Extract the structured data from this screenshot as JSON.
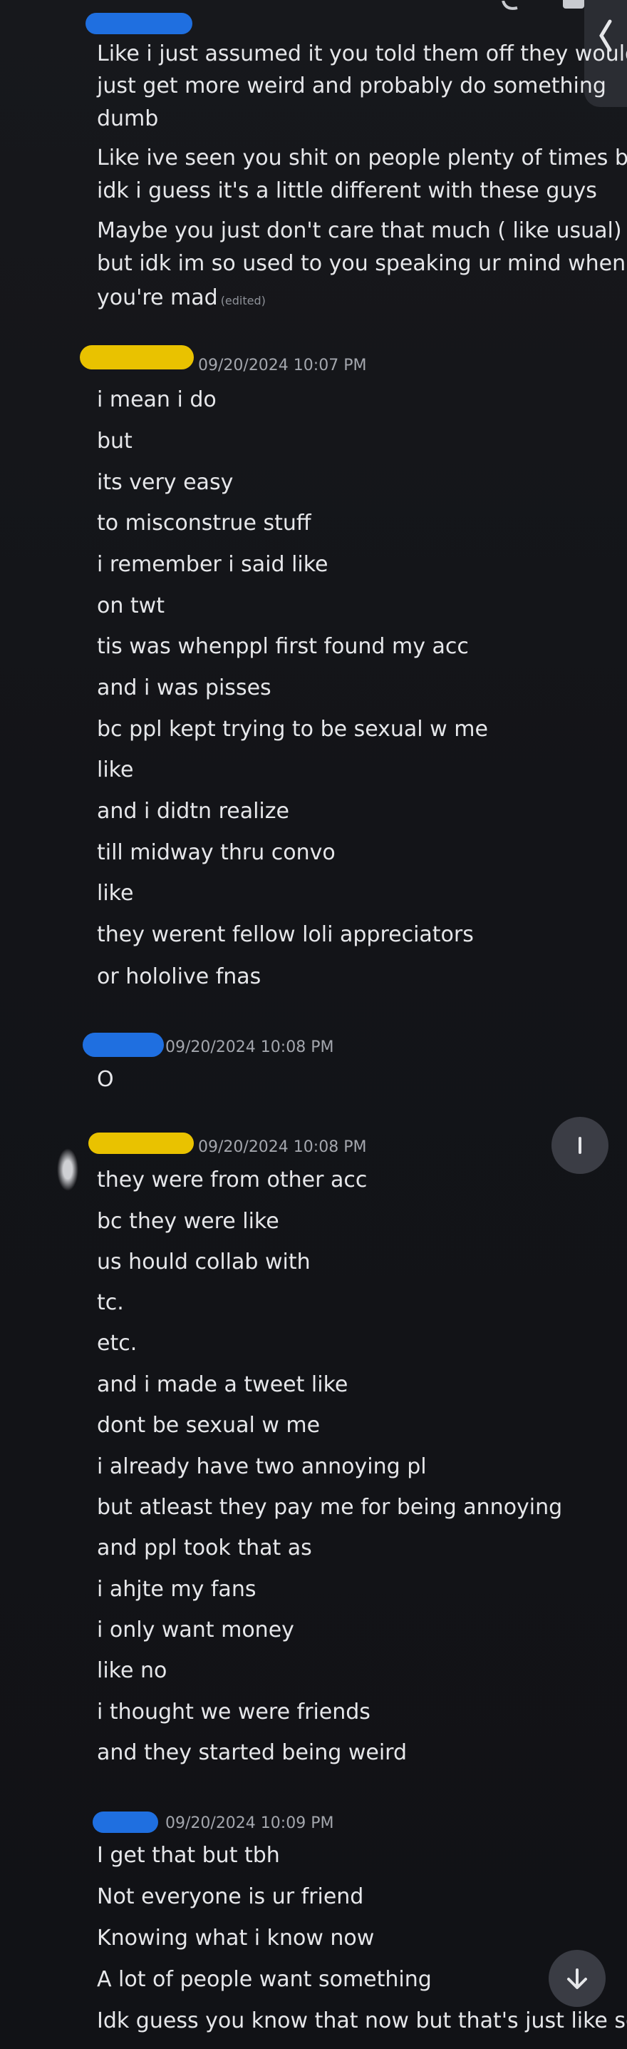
{
  "colors": {
    "background": "#141519",
    "text": "#e6e7ea",
    "timestamp": "#a3a6ad",
    "redact_blue": "#1f6fe0",
    "redact_yellow": "#e9c200",
    "fab": "#3b3d45"
  },
  "icons": {
    "back": "chevron-left-icon",
    "scroll_down": "arrow-down-icon",
    "scroll_up": "arrow-up-icon",
    "phone": "phone-icon"
  },
  "messages": [
    {
      "timestamp": "",
      "lines": [
        "Like i just assumed it you told them off  they would",
        "just get more weird and probably do something",
        "dumb",
        "Like ive seen you shit on people plenty of times but",
        "idk i guess it's a little different with these guys",
        "Maybe you just don't care that much ( like usual)",
        "but idk im so used to you speaking ur mind when",
        "you're mad"
      ],
      "edited": "(edited)"
    },
    {
      "timestamp": "09/20/2024 10:07 PM",
      "lines": [
        "i mean i do",
        "but",
        "its very easy",
        "to misconstrue stuff",
        "i remember i said like",
        "on twt",
        "tis was whenppl first found my acc",
        "and i was pisses",
        "bc ppl kept trying to be sexual w me",
        "like",
        "and i didtn realize",
        "till midway thru convo",
        "like",
        "they werent fellow loli appreciators",
        "or hololive fnas"
      ]
    },
    {
      "timestamp": "09/20/2024 10:08 PM",
      "lines": [
        "O"
      ]
    },
    {
      "timestamp": "09/20/2024 10:08 PM",
      "lines": [
        "they were from other acc",
        "bc they were like",
        "us hould collab with",
        "tc.",
        "etc.",
        "and i made a tweet like",
        "dont be sexual w me",
        "i already have two annoying pl",
        "but atleast they pay me for being annoying",
        "and ppl took that as",
        "i ahjte my fans",
        "i only want money",
        "like no",
        "i thought we were friends",
        "and they started being weird"
      ]
    },
    {
      "timestamp": "09/20/2024 10:09 PM",
      "lines": [
        "I get that but tbh",
        "Not everyone is ur friend",
        "Knowing what i know now",
        "A lot of people want something",
        "Idk guess you know that now but that's just like so"
      ]
    }
  ]
}
